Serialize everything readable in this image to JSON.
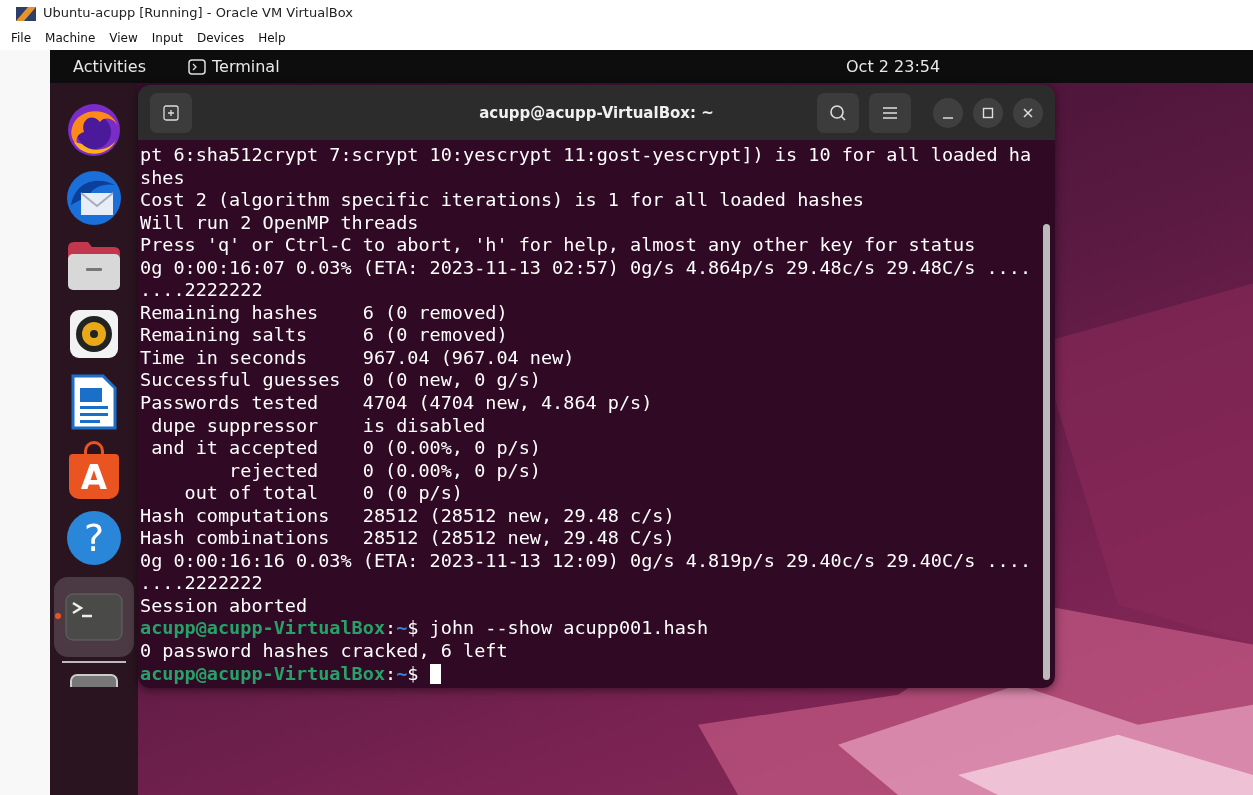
{
  "host_window": {
    "title": "Ubuntu-acupp [Running] - Oracle VM VirtualBox",
    "menu": [
      "File",
      "Machine",
      "View",
      "Input",
      "Devices",
      "Help"
    ]
  },
  "top_bar": {
    "activities": "Activities",
    "app": "Terminal",
    "clock": "Oct 2  23:54"
  },
  "dock": [
    {
      "kind": "browser",
      "running": false
    },
    {
      "kind": "mail",
      "running": false
    },
    {
      "kind": "files",
      "running": false
    },
    {
      "kind": "music",
      "running": false
    },
    {
      "kind": "writer",
      "running": false
    },
    {
      "kind": "store",
      "glyph": "A",
      "running": false
    },
    {
      "kind": "help",
      "glyph": "?",
      "running": false
    },
    {
      "kind": "terminal",
      "running": true
    },
    {
      "kind": "partial",
      "running": false
    }
  ],
  "terminal": {
    "title": "acupp@acupp-VirtualBox: ~",
    "lines": [
      [
        {
          "kind": "text",
          "text": "pt 6:sha512crypt 7:scrypt 10:yescrypt 11:gost-yescrypt]) is 10 for all loaded ha"
        }
      ],
      [
        {
          "kind": "text",
          "text": "shes"
        }
      ],
      [
        {
          "kind": "text",
          "text": "Cost 2 (algorithm specific iterations) is 1 for all loaded hashes"
        }
      ],
      [
        {
          "kind": "text",
          "text": "Will run 2 OpenMP threads"
        }
      ],
      [
        {
          "kind": "text",
          "text": "Press 'q' or Ctrl-C to abort, 'h' for help, almost any other key for status"
        }
      ],
      [
        {
          "kind": "text",
          "text": "0g 0:00:16:07 0.03% (ETA: 2023-11-13 02:57) 0g/s 4.864p/s 29.48c/s 29.48C/s ...."
        }
      ],
      [
        {
          "kind": "text",
          "text": "....2222222"
        }
      ],
      [
        {
          "kind": "text",
          "text": "Remaining hashes    6 (0 removed)"
        }
      ],
      [
        {
          "kind": "text",
          "text": "Remaining salts     6 (0 removed)"
        }
      ],
      [
        {
          "kind": "text",
          "text": "Time in seconds     967.04 (967.04 new)"
        }
      ],
      [
        {
          "kind": "text",
          "text": "Successful guesses  0 (0 new, 0 g/s)"
        }
      ],
      [
        {
          "kind": "text",
          "text": "Passwords tested    4704 (4704 new, 4.864 p/s)"
        }
      ],
      [
        {
          "kind": "text",
          "text": " dupe suppressor    is disabled"
        }
      ],
      [
        {
          "kind": "text",
          "text": " and it accepted    0 (0.00%, 0 p/s)"
        }
      ],
      [
        {
          "kind": "text",
          "text": "        rejected    0 (0.00%, 0 p/s)"
        }
      ],
      [
        {
          "kind": "text",
          "text": "    out of total    0 (0 p/s)"
        }
      ],
      [
        {
          "kind": "text",
          "text": "Hash computations   28512 (28512 new, 29.48 c/s)"
        }
      ],
      [
        {
          "kind": "text",
          "text": "Hash combinations   28512 (28512 new, 29.48 C/s)"
        }
      ],
      [
        {
          "kind": "text",
          "text": "0g 0:00:16:16 0.03% (ETA: 2023-11-13 12:09) 0g/s 4.819p/s 29.40c/s 29.40C/s ...."
        }
      ],
      [
        {
          "kind": "text",
          "text": "....2222222"
        }
      ],
      [
        {
          "kind": "text",
          "text": "Session aborted"
        }
      ],
      [
        {
          "kind": "user",
          "text": "acupp@acupp-VirtualBox"
        },
        {
          "kind": "text",
          "text": ":"
        },
        {
          "kind": "path",
          "text": "~"
        },
        {
          "kind": "text",
          "text": "$ john --show acupp001.hash"
        }
      ],
      [
        {
          "kind": "text",
          "text": "0 password hashes cracked, 6 left"
        }
      ],
      [
        {
          "kind": "user",
          "text": "acupp@acupp-VirtualBox"
        },
        {
          "kind": "text",
          "text": ":"
        },
        {
          "kind": "path",
          "text": "~"
        },
        {
          "kind": "text",
          "text": "$ "
        },
        {
          "kind": "cursor"
        }
      ]
    ]
  }
}
